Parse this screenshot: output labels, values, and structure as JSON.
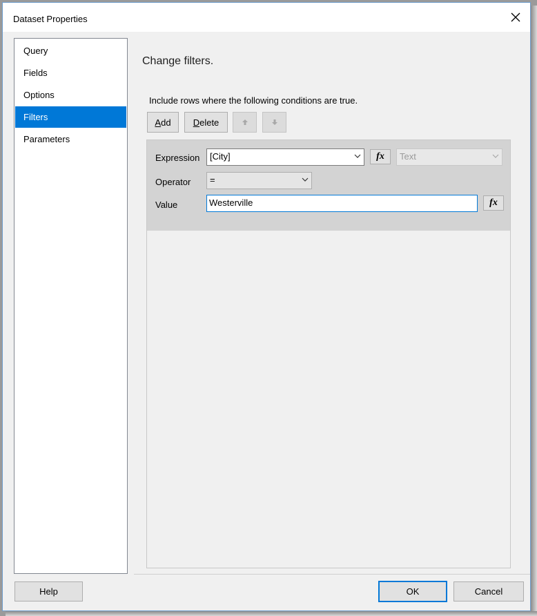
{
  "window": {
    "title": "Dataset Properties"
  },
  "nav": {
    "items": [
      {
        "label": "Query",
        "selected": false
      },
      {
        "label": "Fields",
        "selected": false
      },
      {
        "label": "Options",
        "selected": false
      },
      {
        "label": "Filters",
        "selected": true
      },
      {
        "label": "Parameters",
        "selected": false
      }
    ]
  },
  "main": {
    "heading": "Change filters.",
    "instructions": "Include rows where the following conditions are true.",
    "toolbar": {
      "add_mnemonic": "A",
      "add_rest": "dd",
      "delete_mnemonic": "D",
      "delete_rest": "elete",
      "move_up_icon": "arrow-up-icon",
      "move_down_icon": "arrow-down-icon"
    },
    "filter": {
      "expression_label": "Expression",
      "expression_value": "[City]",
      "type_value": "Text",
      "operator_label": "Operator",
      "operator_value": "=",
      "value_label": "Value",
      "value_value": "Westerville",
      "fx_label": "fx"
    }
  },
  "footer": {
    "help_label": "Help",
    "ok_label": "OK",
    "cancel_label": "Cancel"
  },
  "colors": {
    "accent": "#0078d7",
    "dialog_background": "#f0f0f0",
    "filter_row_background": "#d3d3d3"
  }
}
